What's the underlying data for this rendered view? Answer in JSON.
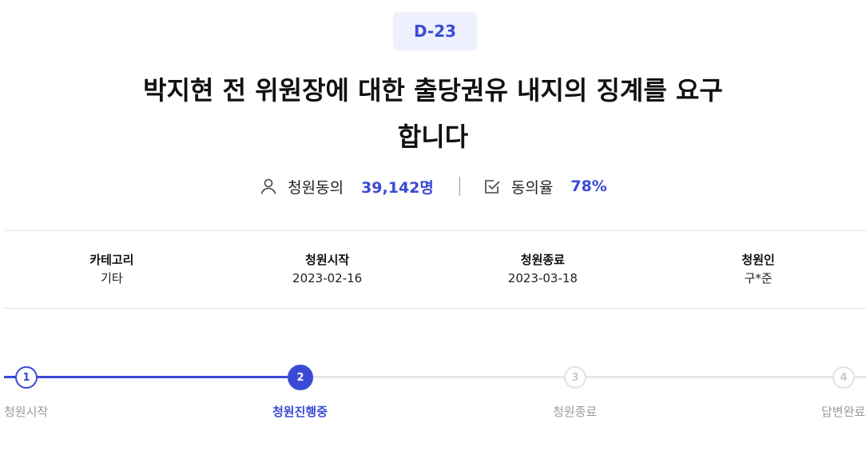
{
  "badge": "D-23",
  "title": {
    "line1": "박지현 전 위원장에 대한 출당권유 내지의 징계를 요구",
    "line2": "합니다"
  },
  "stats": {
    "agree_label": "청원동의",
    "agree_value": "39,142명",
    "rate_label": "동의율",
    "rate_value": "78%",
    "icons": [
      "user-icon",
      "checkbox-icon"
    ]
  },
  "info": [
    {
      "head": "카테고리",
      "value": "기타"
    },
    {
      "head": "청원시작",
      "value": "2023-02-16"
    },
    {
      "head": "청원종료",
      "value": "2023-03-18"
    },
    {
      "head": "청원인",
      "value": "구*준"
    }
  ],
  "steps": [
    {
      "num": "1",
      "label": "청원시작",
      "state": "done"
    },
    {
      "num": "2",
      "label": "청원진행중",
      "state": "current"
    },
    {
      "num": "3",
      "label": "청원종료",
      "state": "todo"
    },
    {
      "num": "4",
      "label": "답변완료",
      "state": "todo"
    }
  ],
  "colors": {
    "accent": "#3b4ad6",
    "badge_bg": "#eef1fd",
    "inactive": "#e6e6e6"
  }
}
